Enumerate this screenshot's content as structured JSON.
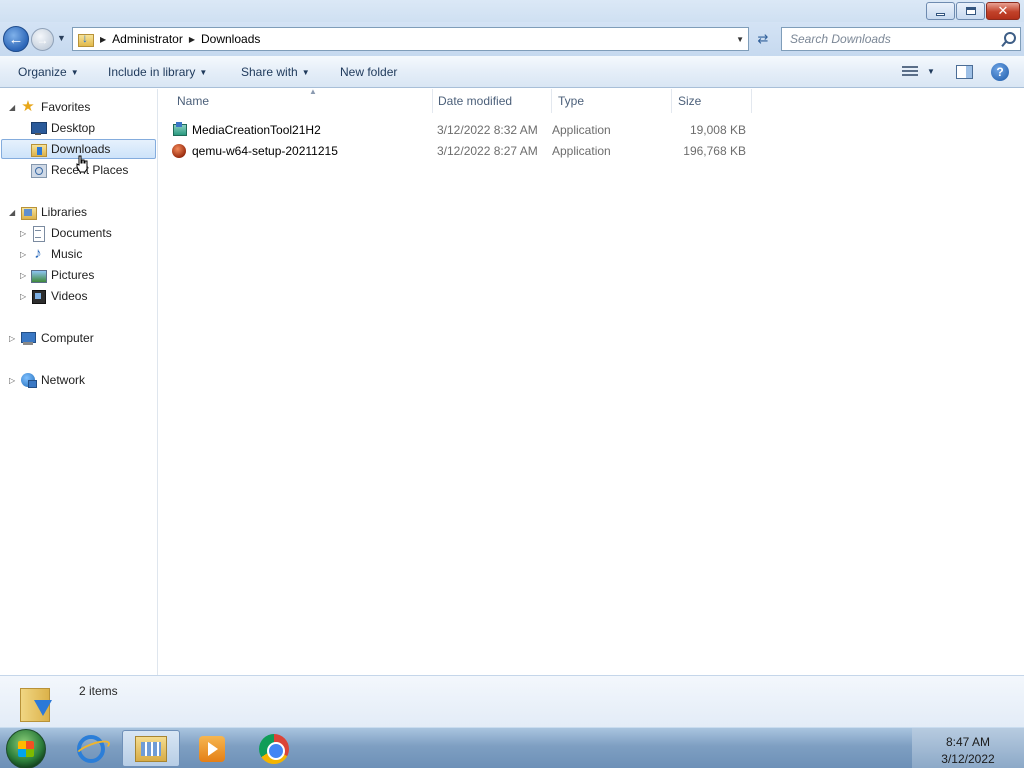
{
  "window": {
    "minimize": "minimize",
    "maximize": "restore",
    "close": "✕"
  },
  "address": {
    "crumbs": [
      "Administrator",
      "Downloads"
    ],
    "search_placeholder": "Search Downloads"
  },
  "toolbar": {
    "organize": "Organize",
    "include_in_library": "Include in library",
    "share_with": "Share with",
    "new_folder": "New folder"
  },
  "nav": {
    "favorites": "Favorites",
    "desktop": "Desktop",
    "downloads": "Downloads",
    "recent_places": "Recent Places",
    "libraries": "Libraries",
    "documents": "Documents",
    "music": "Music",
    "pictures": "Pictures",
    "videos": "Videos",
    "computer": "Computer",
    "network": "Network"
  },
  "columns": {
    "name": "Name",
    "date_modified": "Date modified",
    "type": "Type",
    "size": "Size"
  },
  "files": [
    {
      "name": "MediaCreationTool21H2",
      "date": "3/12/2022 8:32 AM",
      "type": "Application",
      "size": "19,008 KB",
      "icon": "media-creation-tool-icon"
    },
    {
      "name": "qemu-w64-setup-20211215",
      "date": "3/12/2022 8:27 AM",
      "type": "Application",
      "size": "196,768 KB",
      "icon": "qemu-installer-icon"
    }
  ],
  "details": {
    "item_count": "2 items"
  },
  "taskbar": {
    "time": "8:47 AM",
    "date": "3/12/2022"
  }
}
